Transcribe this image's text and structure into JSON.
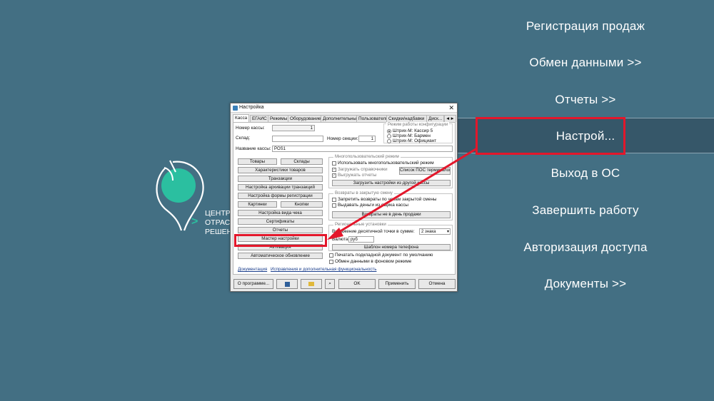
{
  "menu": {
    "items": [
      {
        "label": "Регистрация продаж"
      },
      {
        "label": "Обмен данными >>"
      },
      {
        "label": "Отчеты >>"
      },
      {
        "label": "Настрой..."
      },
      {
        "label": "Выход в ОС"
      },
      {
        "label": "Завершить работу"
      },
      {
        "label": "Авторизация доступа"
      },
      {
        "label": "Документы >>"
      }
    ],
    "active_index": 3
  },
  "logo": {
    "line1": "ЦЕНТР",
    "line2": "ОТРАСЛЕ",
    "line3": "РЕШЕНИЙ",
    "accent": ">"
  },
  "dialog": {
    "title": "Настройка",
    "close": "✕",
    "tabs": [
      "Касса",
      "ЕГАИС",
      "Режимы",
      "Оборудование",
      "Дополнительные",
      "Пользователи",
      "Скидки/надбавки",
      "Диск..."
    ],
    "tab_scroll": "◄►",
    "fields": {
      "cash_number_label": "Номер кассы:",
      "cash_number_value": "1",
      "warehouse_label": "Склад:",
      "section_label": "Номер секции:",
      "section_value": "1",
      "cash_name_label": "Название кассы:",
      "cash_name_value": "POS1"
    },
    "config_mode": {
      "title": "Режим работы конфигурации",
      "options": [
        "Штрих-М: Кассир 5",
        "Штрих-М: Бармен",
        "Штрих-М: Официант"
      ]
    },
    "left_buttons": {
      "goods": "Товары",
      "warehouses": "Склады",
      "goods_props": "Характеристики товаров",
      "transactions": "Транзакции",
      "archive": "Настройка архивации транзакций",
      "reg_form": "Настройка формы регистрации",
      "pictures": "Картинки",
      "buttons": "Кнопки",
      "check_view": "Настройка вида чека",
      "certificates": "Сертификаты",
      "reports": "Отчеты",
      "wizard": "Мастер настройки",
      "activation": "Активация",
      "autoupdate": "Автоматическое обновление"
    },
    "multiuser": {
      "title": "Многопользовательский режим",
      "use": "Использовать многопользовательский режим",
      "load_refs": "Загружать справочники",
      "upload_reports": "Выгружать отчеты",
      "pos_list": "Список ПОС терминалов",
      "load_from": "Загрузить настройки из другой кассы"
    },
    "returns": {
      "title": "Возвраты в закрытую смену",
      "forbid": "Запретить возвраты по чекам закрытой смены",
      "give_money": "Выдавать деньги из ящика кассы",
      "not_same_day": "Возвраты не в день продажи"
    },
    "regional": {
      "title": "Региональные установки",
      "decimal_label": "Выражение десятичной точки в сумме:",
      "decimal_value": "2 знака",
      "currency_label": "Валюта:",
      "currency_value": "руб",
      "phone_template": "Шаблон номера телефона"
    },
    "print_default": "Печатать подкладной документ по умолчанию",
    "background_exchange": "Обмен данными в фоновом режиме",
    "links": {
      "docs": "Документация",
      "fixes": "Исправления и дополнительная функциональность"
    },
    "bottom": {
      "about": "О программе...",
      "ok": "OK",
      "apply": "Применить",
      "cancel": "Отмена"
    }
  },
  "colors": {
    "background": "#436f83",
    "active_menu": "#365769",
    "highlight": "#e3172b",
    "logo_accent": "#2bbfa0"
  }
}
